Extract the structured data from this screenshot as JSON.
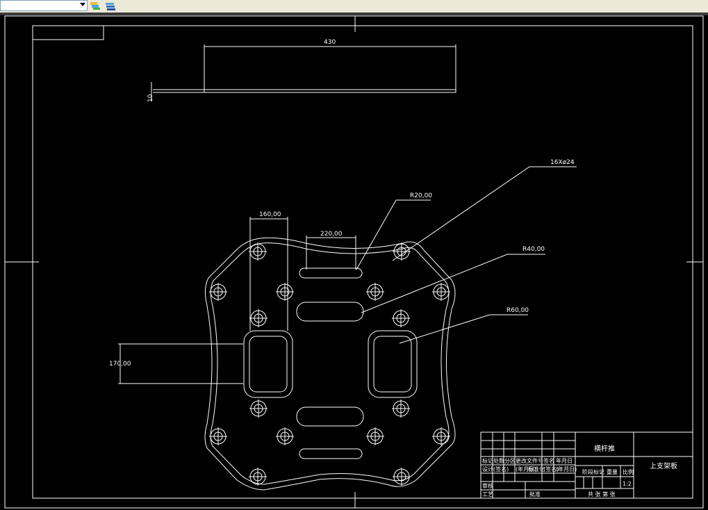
{
  "app": {
    "toolbar_icons": [
      "layer-stack-icon",
      "layer-properties-icon"
    ]
  },
  "drawing": {
    "side_view": {
      "length_dim": "430",
      "thickness_dim": "10"
    },
    "plate": {
      "hole_callout": "16Xø24",
      "r20": "R20,00",
      "r40": "R40,00",
      "r60": "R60,00",
      "w160": "160,00",
      "w220": "220,00",
      "h170": "170,00"
    },
    "title_block": {
      "project_name": "横杆推",
      "part_name": "上支架板",
      "scale": "1:2",
      "row_labels": [
        "标记",
        "处数",
        "分区",
        "更改文件号",
        "签名",
        "年月日"
      ],
      "row2_labels": [
        "设计",
        "(签名)",
        "(年月日)",
        "标准化",
        "(签名)",
        "(年月日)"
      ],
      "stage_labels": [
        "阶段标记",
        "重量",
        "比例"
      ],
      "review": "审核",
      "process": "工艺",
      "approve": "批准",
      "sheets": "共 张 第 张"
    }
  },
  "colors": {
    "background": "#000000",
    "lines": "#ffffff"
  }
}
